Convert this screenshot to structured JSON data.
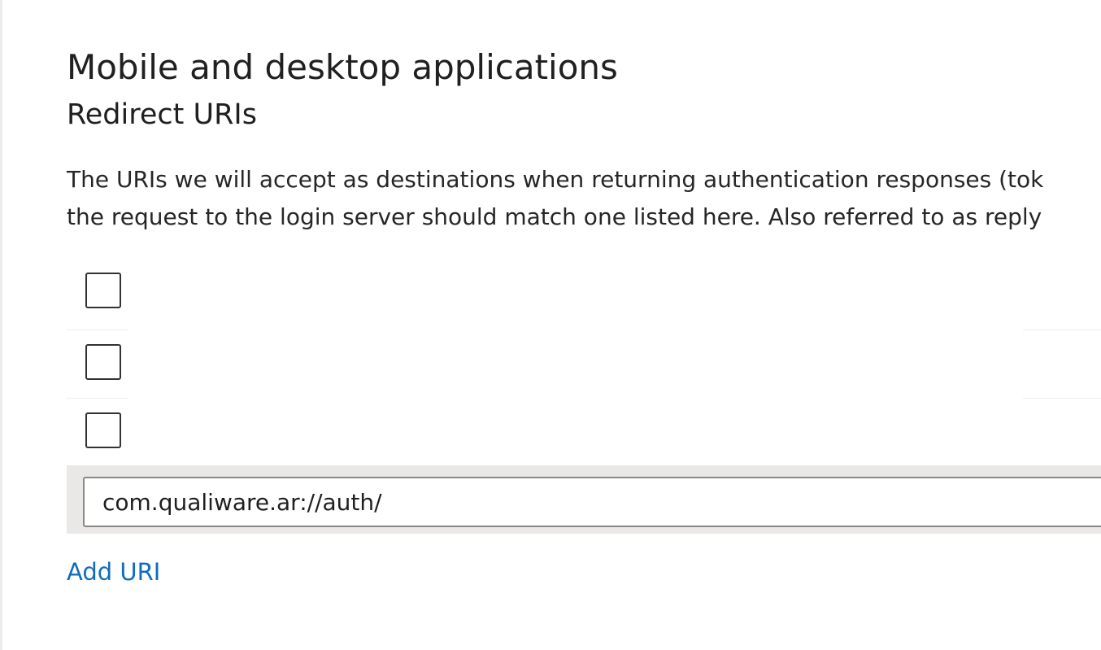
{
  "section": {
    "title": "Mobile and desktop applications",
    "subtitle": "Redirect URIs",
    "description_lines": [
      "The URIs we will accept as destinations when returning authentication responses (tok",
      "the request to the login server should match one listed here. Also referred to as reply"
    ]
  },
  "redirect_uris": {
    "rows": [
      {
        "checked": false
      },
      {
        "checked": false
      },
      {
        "checked": false
      }
    ],
    "edit_value": "com.qualiware.ar://auth/"
  },
  "actions": {
    "add_uri_label": "Add URI"
  },
  "colors": {
    "link": "#0f6cbd",
    "edit_row_background": "#eae8e6",
    "input_border": "#8a8886"
  }
}
